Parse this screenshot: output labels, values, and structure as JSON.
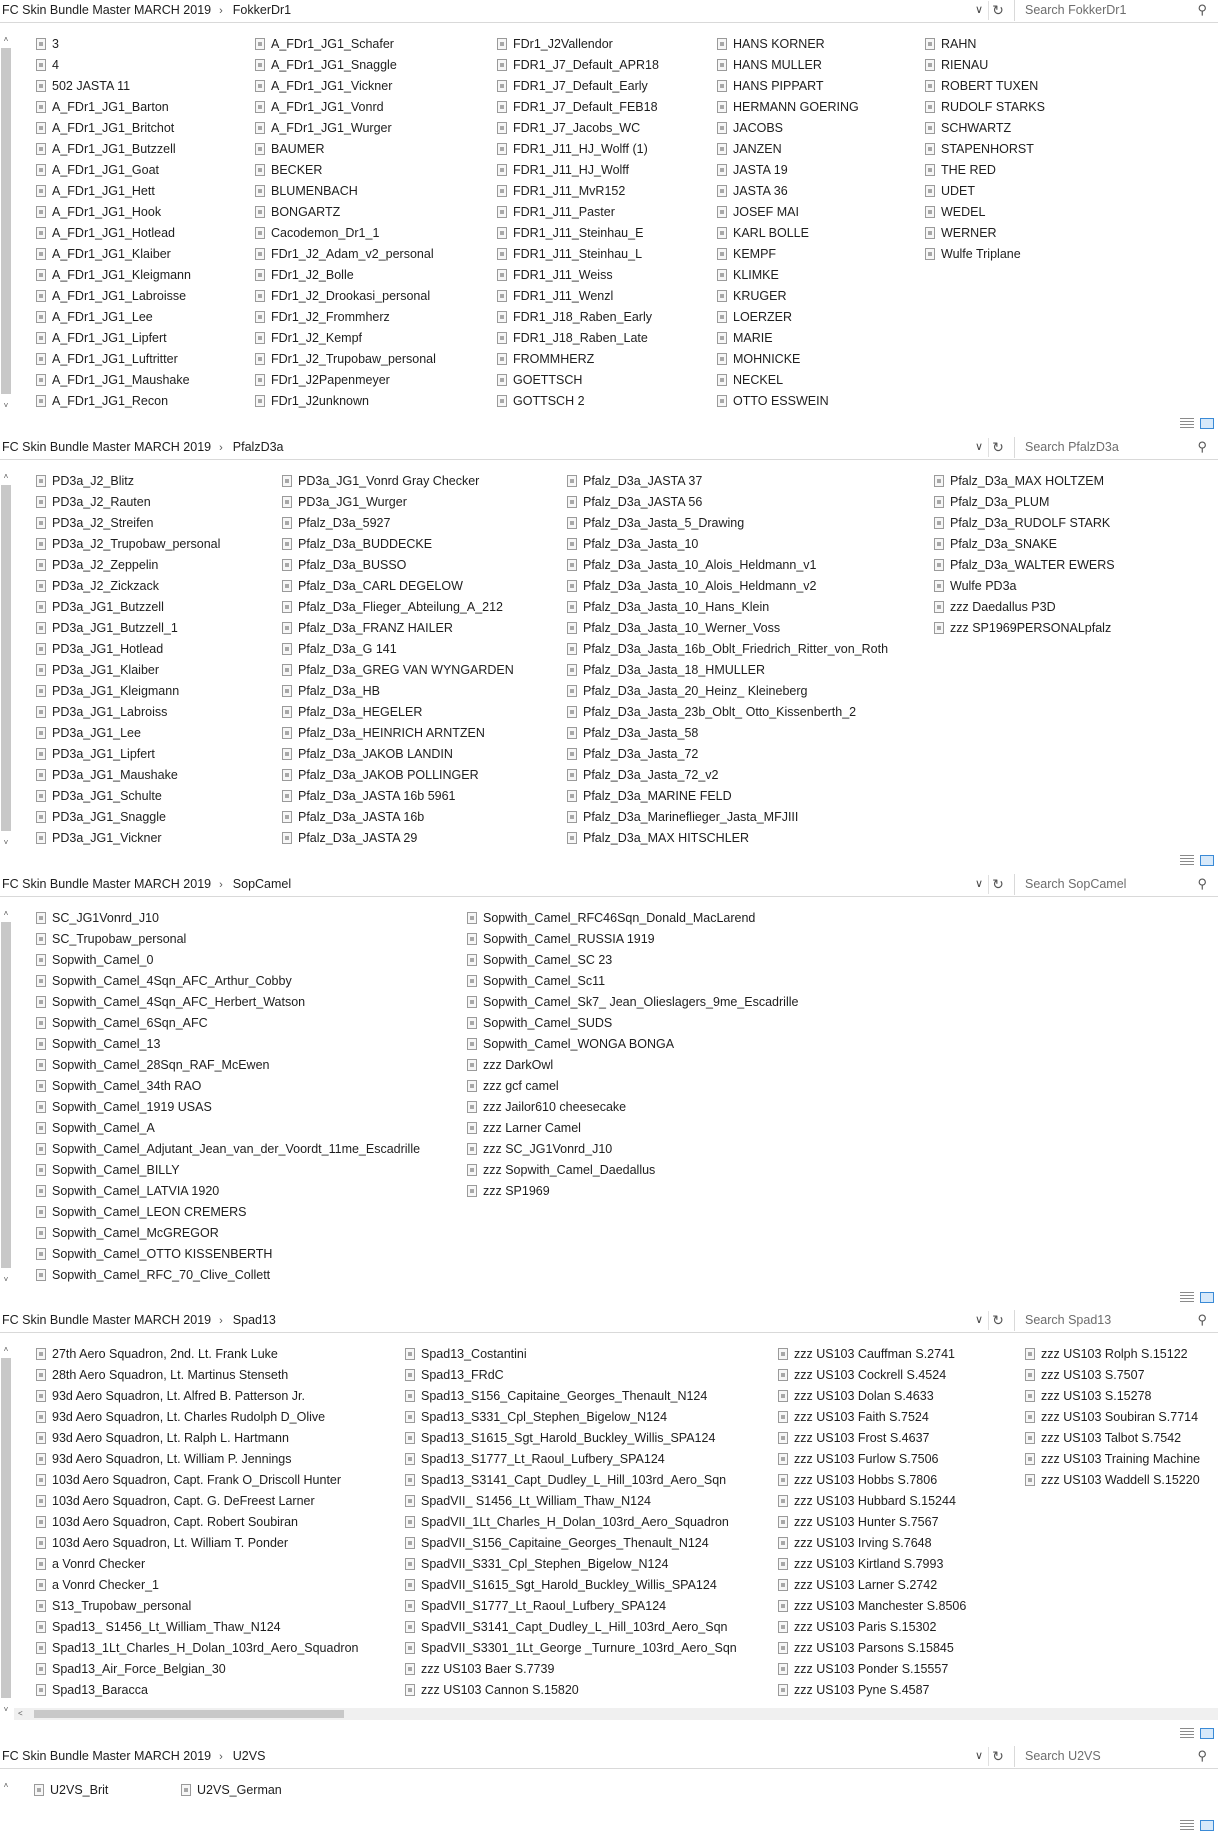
{
  "panels": [
    {
      "root": "FC Skin Bundle Master MARCH 2019",
      "folder": "FokkerDr1",
      "search_placeholder": "Search FokkerDr1",
      "columns": [
        [
          "3",
          "4",
          "502 JASTA 11",
          "A_FDr1_JG1_Barton",
          "A_FDr1_JG1_Britchot",
          "A_FDr1_JG1_Butzzell",
          "A_FDr1_JG1_Goat",
          "A_FDr1_JG1_Hett",
          "A_FDr1_JG1_Hook",
          "A_FDr1_JG1_Hotlead",
          "A_FDr1_JG1_Klaiber",
          "A_FDr1_JG1_Kleigmann",
          "A_FDr1_JG1_Labroisse",
          "A_FDr1_JG1_Lee",
          "A_FDr1_JG1_Lipfert",
          "A_FDr1_JG1_Luftritter",
          "A_FDr1_JG1_Maushake",
          "A_FDr1_JG1_Recon"
        ],
        [
          "A_FDr1_JG1_Schafer",
          "A_FDr1_JG1_Snaggle",
          "A_FDr1_JG1_Vickner",
          "A_FDr1_JG1_Vonrd",
          "A_FDr1_JG1_Wurger",
          "BAUMER",
          "BECKER",
          "BLUMENBACH",
          "BONGARTZ",
          "Cacodemon_Dr1_1",
          "FDr1_J2_Adam_v2_personal",
          "FDr1_J2_Bolle",
          "FDr1_J2_Drookasi_personal",
          "FDr1_J2_Frommherz",
          "FDr1_J2_Kempf",
          "FDr1_J2_Trupobaw_personal",
          "FDr1_J2Papenmeyer",
          "FDr1_J2unknown"
        ],
        [
          "FDr1_J2Vallendor",
          "FDR1_J7_Default_APR18",
          "FDR1_J7_Default_Early",
          "FDR1_J7_Default_FEB18",
          "FDR1_J7_Jacobs_WC",
          "FDR1_J11_HJ_Wolff (1)",
          "FDR1_J11_HJ_Wolff",
          "FDR1_J11_MvR152",
          "FDR1_J11_Paster",
          "FDR1_J11_Steinhau_E",
          "FDR1_J11_Steinhau_L",
          "FDR1_J11_Weiss",
          "FDR1_J11_Wenzl",
          "FDR1_J18_Raben_Early",
          "FDR1_J18_Raben_Late",
          "FROMMHERZ",
          "GOETTSCH",
          "GOTTSCH 2"
        ],
        [
          "HANS KORNER",
          "HANS MULLER",
          "HANS PIPPART",
          "HERMANN GOERING",
          "JACOBS",
          "JANZEN",
          "JASTA 19",
          "JASTA 36",
          "JOSEF MAI",
          "KARL BOLLE",
          "KEMPF",
          "KLIMKE",
          "KRUGER",
          "LOERZER",
          "MARIE",
          "MOHNICKE",
          "NECKEL",
          "OTTO  ESSWEIN"
        ],
        [
          "RAHN",
          "RIENAU",
          "ROBERT TUXEN",
          "RUDOLF STARKS",
          "SCHWARTZ",
          "STAPENHORST",
          "THE RED",
          "UDET",
          "WEDEL",
          "WERNER",
          "Wulfe Triplane"
        ]
      ]
    },
    {
      "root": "FC Skin Bundle Master MARCH 2019",
      "folder": "PfalzD3a",
      "search_placeholder": "Search PfalzD3a",
      "columns": [
        [
          "PD3a_J2_Blitz",
          "PD3a_J2_Rauten",
          "PD3a_J2_Streifen",
          "PD3a_J2_Trupobaw_personal",
          "PD3a_J2_Zeppelin",
          "PD3a_J2_Zickzack",
          "PD3a_JG1_Butzzell",
          "PD3a_JG1_Butzzell_1",
          "PD3a_JG1_Hotlead",
          "PD3a_JG1_Klaiber",
          "PD3a_JG1_Kleigmann",
          "PD3a_JG1_Labroiss",
          "PD3a_JG1_Lee",
          "PD3a_JG1_Lipfert",
          "PD3a_JG1_Maushake",
          "PD3a_JG1_Schulte",
          "PD3a_JG1_Snaggle",
          "PD3a_JG1_Vickner"
        ],
        [
          "PD3a_JG1_Vonrd Gray Checker",
          "PD3a_JG1_Wurger",
          "Pfalz_D3a_5927",
          "Pfalz_D3a_BUDDECKE",
          "Pfalz_D3a_BUSSO",
          "Pfalz_D3a_CARL DEGELOW",
          "Pfalz_D3a_Flieger_Abteilung_A_212",
          "Pfalz_D3a_FRANZ HAILER",
          "Pfalz_D3a_G 141",
          "Pfalz_D3a_GREG VAN  WYNGARDEN",
          "Pfalz_D3a_HB",
          "Pfalz_D3a_HEGELER",
          "Pfalz_D3a_HEINRICH ARNTZEN",
          "Pfalz_D3a_JAKOB LANDIN",
          "Pfalz_D3a_JAKOB POLLINGER",
          "Pfalz_D3a_JASTA 16b 5961",
          "Pfalz_D3a_JASTA 16b",
          "Pfalz_D3a_JASTA 29"
        ],
        [
          "Pfalz_D3a_JASTA 37",
          "Pfalz_D3a_JASTA 56",
          "Pfalz_D3a_Jasta_5_Drawing",
          "Pfalz_D3a_Jasta_10",
          "Pfalz_D3a_Jasta_10_Alois_Heldmann_v1",
          "Pfalz_D3a_Jasta_10_Alois_Heldmann_v2",
          "Pfalz_D3a_Jasta_10_Hans_Klein",
          "Pfalz_D3a_Jasta_10_Werner_Voss",
          "Pfalz_D3a_Jasta_16b_Oblt_Friedrich_Ritter_von_Roth",
          "Pfalz_D3a_Jasta_18_HMULLER",
          "Pfalz_D3a_Jasta_20_Heinz_ Kleineberg",
          "Pfalz_D3a_Jasta_23b_Oblt_ Otto_Kissenberth_2",
          "Pfalz_D3a_Jasta_58",
          "Pfalz_D3a_Jasta_72",
          "Pfalz_D3a_Jasta_72_v2",
          "Pfalz_D3a_MARINE FELD",
          "Pfalz_D3a_Marineflieger_Jasta_MFJIII",
          "Pfalz_D3a_MAX HITSCHLER"
        ],
        [
          "Pfalz_D3a_MAX HOLTZEM",
          "Pfalz_D3a_PLUM",
          "Pfalz_D3a_RUDOLF STARK",
          "Pfalz_D3a_SNAKE",
          "Pfalz_D3a_WALTER  EWERS",
          "Wulfe PD3a",
          "zzz Daedallus P3D",
          "zzz SP1969PERSONALpfalz"
        ]
      ]
    },
    {
      "root": "FC Skin Bundle Master MARCH 2019",
      "folder": "SopCamel",
      "search_placeholder": "Search SopCamel",
      "columns": [
        [
          "SC_JG1Vonrd_J10",
          "SC_Trupobaw_personal",
          "Sopwith_Camel_0",
          "Sopwith_Camel_4Sqn_AFC_Arthur_Cobby",
          "Sopwith_Camel_4Sqn_AFC_Herbert_Watson",
          "Sopwith_Camel_6Sqn_AFC",
          "Sopwith_Camel_13",
          "Sopwith_Camel_28Sqn_RAF_McEwen",
          "Sopwith_Camel_34th RAO",
          "Sopwith_Camel_1919 USAS",
          "Sopwith_Camel_A",
          "Sopwith_Camel_Adjutant_Jean_van_der_Voordt_11me_Escadrille",
          "Sopwith_Camel_BILLY",
          "Sopwith_Camel_LATVIA 1920",
          "Sopwith_Camel_LEON CREMERS",
          "Sopwith_Camel_McGREGOR",
          "Sopwith_Camel_OTTO KISSENBERTH",
          "Sopwith_Camel_RFC_70_Clive_Collett"
        ],
        [
          "Sopwith_Camel_RFC46Sqn_Donald_MacLarend",
          "Sopwith_Camel_RUSSIA 1919",
          "Sopwith_Camel_SC 23",
          "Sopwith_Camel_Sc11",
          "Sopwith_Camel_Sk7_ Jean_Olieslagers_9me_Escadrille",
          "Sopwith_Camel_SUDS",
          "Sopwith_Camel_WONGA BONGA",
          "zzz DarkOwl",
          "zzz gcf camel",
          "zzz Jailor610 cheesecake",
          "zzz Larner Camel",
          "zzz SC_JG1Vonrd_J10",
          "zzz Sopwith_Camel_Daedallus",
          "zzz SP1969"
        ]
      ]
    },
    {
      "root": "FC Skin Bundle Master MARCH 2019",
      "folder": "Spad13",
      "search_placeholder": "Search Spad13",
      "columns": [
        [
          "27th Aero Squadron, 2nd. Lt. Frank Luke",
          "28th Aero Squadron, Lt. Martinus Stenseth",
          "93d Aero Squadron, Lt. Alfred B. Patterson Jr.",
          "93d Aero Squadron, Lt. Charles Rudolph D_Olive",
          "93d Aero Squadron, Lt. Ralph L. Hartmann",
          "93d Aero Squadron, Lt. William P. Jennings",
          "103d Aero Squadron, Capt. Frank O_Driscoll Hunter",
          "103d Aero Squadron, Capt. G. DeFreest Larner",
          "103d Aero Squadron, Capt. Robert Soubiran",
          "103d Aero Squadron, Lt. William T. Ponder",
          "a Vonrd Checker",
          "a Vonrd Checker_1",
          "S13_Trupobaw_personal",
          "Spad13_ S1456_Lt_William_Thaw_N124",
          "Spad13_1Lt_Charles_H_Dolan_103rd_Aero_Squadron",
          "Spad13_Air_Force_Belgian_30",
          "Spad13_Baracca"
        ],
        [
          "Spad13_Costantini",
          "Spad13_FRdC",
          "Spad13_S156_Capitaine_Georges_Thenault_N124",
          "Spad13_S331_Cpl_Stephen_Bigelow_N124",
          "Spad13_S1615_Sgt_Harold_Buckley_Willis_SPA124",
          "Spad13_S1777_Lt_Raoul_Lufbery_SPA124",
          "Spad13_S3141_Capt_Dudley_L_Hill_103rd_Aero_Sqn",
          "SpadVII_ S1456_Lt_William_Thaw_N124",
          "SpadVII_1Lt_Charles_H_Dolan_103rd_Aero_Squadron",
          "SpadVII_S156_Capitaine_Georges_Thenault_N124",
          "SpadVII_S331_Cpl_Stephen_Bigelow_N124",
          "SpadVII_S1615_Sgt_Harold_Buckley_Willis_SPA124",
          "SpadVII_S1777_Lt_Raoul_Lufbery_SPA124",
          "SpadVII_S3141_Capt_Dudley_L_Hill_103rd_Aero_Sqn",
          "SpadVII_S3301_1Lt_George _Turnure_103rd_Aero_Sqn",
          "zzz US103 Baer S.7739",
          "zzz US103 Cannon S.15820"
        ],
        [
          "zzz US103 Cauffman S.2741",
          "zzz US103 Cockrell S.4524",
          "zzz US103 Dolan S.4633",
          "zzz US103 Faith S.7524",
          "zzz US103 Frost S.4637",
          "zzz US103 Furlow S.7506",
          "zzz US103 Hobbs S.7806",
          "zzz US103 Hubbard S.15244",
          "zzz US103 Hunter S.7567",
          "zzz US103 Irving S.7648",
          "zzz US103 Kirtland S.7993",
          "zzz US103 Larner S.2742",
          "zzz US103 Manchester S.8506",
          "zzz US103 Paris S.15302",
          "zzz US103 Parsons S.15845",
          "zzz US103 Ponder S.15557",
          "zzz US103 Pyne S.4587"
        ],
        [
          "zzz US103 Rolph S.15122",
          "zzz US103 S.7507",
          "zzz US103 S.15278",
          "zzz US103 Soubiran S.7714",
          "zzz US103 Talbot S.7542",
          "zzz US103 Training Machine",
          "zzz US103 Waddell S.15220"
        ]
      ]
    },
    {
      "root": "FC Skin Bundle Master MARCH 2019",
      "folder": "U2VS",
      "search_placeholder": "Search U2VS",
      "columns": [
        [
          "U2VS_Brit"
        ],
        [
          "U2VS_German"
        ]
      ]
    }
  ]
}
